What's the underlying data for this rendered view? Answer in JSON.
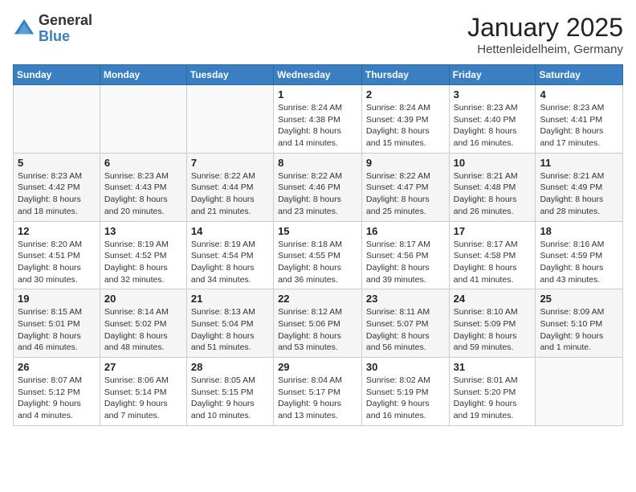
{
  "header": {
    "logo_general": "General",
    "logo_blue": "Blue",
    "title": "January 2025",
    "subtitle": "Hettenleidelheim, Germany"
  },
  "days_of_week": [
    "Sunday",
    "Monday",
    "Tuesday",
    "Wednesday",
    "Thursday",
    "Friday",
    "Saturday"
  ],
  "weeks": [
    [
      {
        "day": "",
        "info": ""
      },
      {
        "day": "",
        "info": ""
      },
      {
        "day": "",
        "info": ""
      },
      {
        "day": "1",
        "info": "Sunrise: 8:24 AM\nSunset: 4:38 PM\nDaylight: 8 hours\nand 14 minutes."
      },
      {
        "day": "2",
        "info": "Sunrise: 8:24 AM\nSunset: 4:39 PM\nDaylight: 8 hours\nand 15 minutes."
      },
      {
        "day": "3",
        "info": "Sunrise: 8:23 AM\nSunset: 4:40 PM\nDaylight: 8 hours\nand 16 minutes."
      },
      {
        "day": "4",
        "info": "Sunrise: 8:23 AM\nSunset: 4:41 PM\nDaylight: 8 hours\nand 17 minutes."
      }
    ],
    [
      {
        "day": "5",
        "info": "Sunrise: 8:23 AM\nSunset: 4:42 PM\nDaylight: 8 hours\nand 18 minutes."
      },
      {
        "day": "6",
        "info": "Sunrise: 8:23 AM\nSunset: 4:43 PM\nDaylight: 8 hours\nand 20 minutes."
      },
      {
        "day": "7",
        "info": "Sunrise: 8:22 AM\nSunset: 4:44 PM\nDaylight: 8 hours\nand 21 minutes."
      },
      {
        "day": "8",
        "info": "Sunrise: 8:22 AM\nSunset: 4:46 PM\nDaylight: 8 hours\nand 23 minutes."
      },
      {
        "day": "9",
        "info": "Sunrise: 8:22 AM\nSunset: 4:47 PM\nDaylight: 8 hours\nand 25 minutes."
      },
      {
        "day": "10",
        "info": "Sunrise: 8:21 AM\nSunset: 4:48 PM\nDaylight: 8 hours\nand 26 minutes."
      },
      {
        "day": "11",
        "info": "Sunrise: 8:21 AM\nSunset: 4:49 PM\nDaylight: 8 hours\nand 28 minutes."
      }
    ],
    [
      {
        "day": "12",
        "info": "Sunrise: 8:20 AM\nSunset: 4:51 PM\nDaylight: 8 hours\nand 30 minutes."
      },
      {
        "day": "13",
        "info": "Sunrise: 8:19 AM\nSunset: 4:52 PM\nDaylight: 8 hours\nand 32 minutes."
      },
      {
        "day": "14",
        "info": "Sunrise: 8:19 AM\nSunset: 4:54 PM\nDaylight: 8 hours\nand 34 minutes."
      },
      {
        "day": "15",
        "info": "Sunrise: 8:18 AM\nSunset: 4:55 PM\nDaylight: 8 hours\nand 36 minutes."
      },
      {
        "day": "16",
        "info": "Sunrise: 8:17 AM\nSunset: 4:56 PM\nDaylight: 8 hours\nand 39 minutes."
      },
      {
        "day": "17",
        "info": "Sunrise: 8:17 AM\nSunset: 4:58 PM\nDaylight: 8 hours\nand 41 minutes."
      },
      {
        "day": "18",
        "info": "Sunrise: 8:16 AM\nSunset: 4:59 PM\nDaylight: 8 hours\nand 43 minutes."
      }
    ],
    [
      {
        "day": "19",
        "info": "Sunrise: 8:15 AM\nSunset: 5:01 PM\nDaylight: 8 hours\nand 46 minutes."
      },
      {
        "day": "20",
        "info": "Sunrise: 8:14 AM\nSunset: 5:02 PM\nDaylight: 8 hours\nand 48 minutes."
      },
      {
        "day": "21",
        "info": "Sunrise: 8:13 AM\nSunset: 5:04 PM\nDaylight: 8 hours\nand 51 minutes."
      },
      {
        "day": "22",
        "info": "Sunrise: 8:12 AM\nSunset: 5:06 PM\nDaylight: 8 hours\nand 53 minutes."
      },
      {
        "day": "23",
        "info": "Sunrise: 8:11 AM\nSunset: 5:07 PM\nDaylight: 8 hours\nand 56 minutes."
      },
      {
        "day": "24",
        "info": "Sunrise: 8:10 AM\nSunset: 5:09 PM\nDaylight: 8 hours\nand 59 minutes."
      },
      {
        "day": "25",
        "info": "Sunrise: 8:09 AM\nSunset: 5:10 PM\nDaylight: 9 hours\nand 1 minute."
      }
    ],
    [
      {
        "day": "26",
        "info": "Sunrise: 8:07 AM\nSunset: 5:12 PM\nDaylight: 9 hours\nand 4 minutes."
      },
      {
        "day": "27",
        "info": "Sunrise: 8:06 AM\nSunset: 5:14 PM\nDaylight: 9 hours\nand 7 minutes."
      },
      {
        "day": "28",
        "info": "Sunrise: 8:05 AM\nSunset: 5:15 PM\nDaylight: 9 hours\nand 10 minutes."
      },
      {
        "day": "29",
        "info": "Sunrise: 8:04 AM\nSunset: 5:17 PM\nDaylight: 9 hours\nand 13 minutes."
      },
      {
        "day": "30",
        "info": "Sunrise: 8:02 AM\nSunset: 5:19 PM\nDaylight: 9 hours\nand 16 minutes."
      },
      {
        "day": "31",
        "info": "Sunrise: 8:01 AM\nSunset: 5:20 PM\nDaylight: 9 hours\nand 19 minutes."
      },
      {
        "day": "",
        "info": ""
      }
    ]
  ]
}
